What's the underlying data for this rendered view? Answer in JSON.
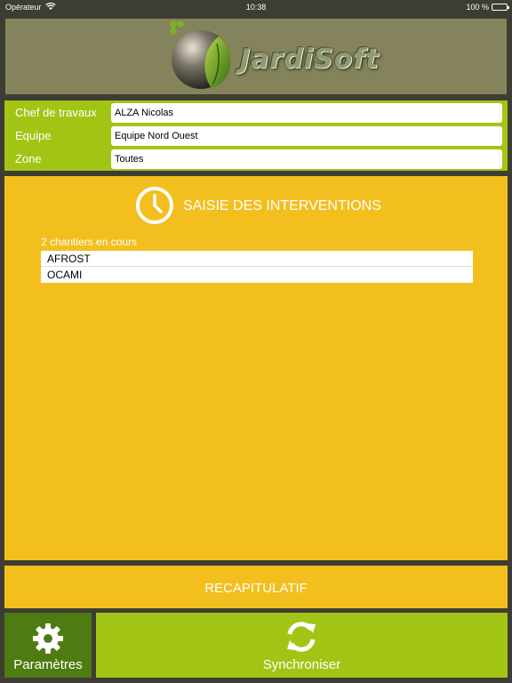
{
  "status_bar": {
    "carrier": "Opérateur",
    "time": "10:38",
    "battery": "100 %"
  },
  "header": {
    "logo_text": "JardiSoft"
  },
  "info": {
    "rows": [
      {
        "label": "Chef de travaux",
        "value": "ALZA Nicolas"
      },
      {
        "label": "Equipe",
        "value": "Equipe Nord Ouest"
      },
      {
        "label": "Zone",
        "value": "Toutes"
      }
    ]
  },
  "main": {
    "title": "SAISIE DES INTERVENTIONS",
    "count_text": "2 chantiers en cours",
    "items": [
      "AFROST",
      "OCAMI"
    ]
  },
  "recap": {
    "label": "RECAPITULATIF"
  },
  "footer": {
    "params_label": "Paramètres",
    "sync_label": "Synchroniser"
  },
  "colors": {
    "background": "#3d3d33",
    "header": "#84835b",
    "green": "#a2c515",
    "dark_green": "#4f7c12",
    "yellow": "#f2bf1f"
  },
  "icons": {
    "wifi": "wifi-icon",
    "clock": "clock-icon",
    "gear": "gear-icon",
    "sync": "sync-icon",
    "logo": "logo-icon"
  }
}
